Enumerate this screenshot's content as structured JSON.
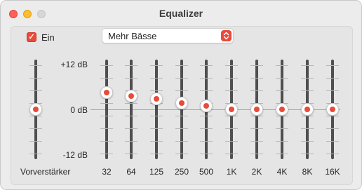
{
  "window": {
    "title": "Equalizer",
    "accent_color": "#e94a3a"
  },
  "toolbar": {
    "enabled_label": "Ein",
    "enabled": true,
    "preset": "Mehr Bässe"
  },
  "scale": {
    "top": "+12 dB",
    "middle": "0 dB",
    "bottom": "-12 dB",
    "max_db": 12,
    "min_db": -12
  },
  "preamp": {
    "label": "Vorverstärker",
    "value_db": 0
  },
  "bands": [
    {
      "label": "32",
      "value_db": 4
    },
    {
      "label": "64",
      "value_db": 3.2
    },
    {
      "label": "125",
      "value_db": 2.6
    },
    {
      "label": "250",
      "value_db": 1.6
    },
    {
      "label": "500",
      "value_db": 0.8
    },
    {
      "label": "1K",
      "value_db": 0
    },
    {
      "label": "2K",
      "value_db": 0
    },
    {
      "label": "4K",
      "value_db": 0
    },
    {
      "label": "8K",
      "value_db": 0
    },
    {
      "label": "16K",
      "value_db": 0
    }
  ]
}
